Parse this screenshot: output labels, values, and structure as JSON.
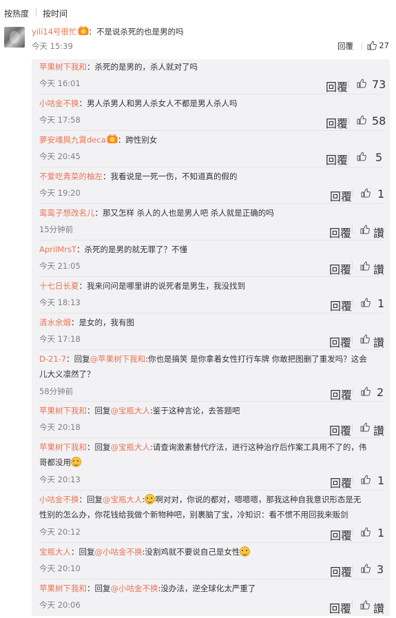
{
  "tabs": {
    "hot": "按热度",
    "time": "按时间"
  },
  "main_comment": {
    "nick": "yili14号很忙",
    "text": "：不是说杀死的也是男的吗",
    "time": "今天 15:39",
    "reply_label": "回覆",
    "likes": "27"
  },
  "replies": [
    {
      "nick": "苹果树下我和",
      "text": "：杀死的是男的，杀人就对了吗",
      "time": "今天 16:01",
      "reply_label": "回覆",
      "likes": "73"
    },
    {
      "nick": "小咕金不换",
      "text": "：男人杀男人和男人杀女人不都是男人杀人吗",
      "time": "今天 17:58",
      "reply_label": "回覆",
      "likes": "58"
    },
    {
      "nick": "夢安魂與九霄deca",
      "text": "：跨性别女",
      "time": "今天 20:45",
      "reply_label": "回覆",
      "likes": "5"
    },
    {
      "nick": "不爱吃青菜的柚左",
      "text": "：我看说是一死一伤，不知道真的假的",
      "time": "今天 19:20",
      "reply_label": "回覆",
      "likes": "1"
    },
    {
      "nick": "鸾鸾子想改名儿",
      "text": "：那又怎样 杀人的人也是男人吧 杀人就是正确的吗",
      "time": "15分钟前",
      "reply_label": "回覆",
      "likes": "讚"
    },
    {
      "nick": "AprilMrsT",
      "text": "：杀死的是男的就无罪了？不懂",
      "time": "今天 21:05",
      "reply_label": "回覆",
      "likes": "讚"
    },
    {
      "nick": "十七日长夏",
      "text": "：我来问问是哪里讲的说死者是男生，我没找到",
      "time": "今天 18:13",
      "reply_label": "回覆",
      "likes": "1"
    },
    {
      "nick": "清水余烟",
      "text": "：是女的，我有图",
      "time": "今天 17:18",
      "reply_label": "回覆",
      "likes": "讚"
    },
    {
      "nick": "D-21-7",
      "pre": "：回复",
      "at": "@苹果树下我和",
      "text": ":你也是搞笑 是你拿着女性打行车牌 你敢把图删了重发吗？这会",
      "text2": "儿大义凛然了？",
      "time": "58分钟前",
      "reply_label": "回覆",
      "likes": "2"
    },
    {
      "nick": "苹果树下我和",
      "pre": "：回复",
      "at": "@宝瓶大人",
      "text": ":鉴于这种言论，去答题吧",
      "time": "今天 20:18",
      "reply_label": "回覆",
      "likes": "讚"
    },
    {
      "nick": "苹果树下我和",
      "pre": "：回复",
      "at": "@宝瓶大人",
      "text": ":请查询激素替代疗法，进行这种治疗后作案工具用不了的，伟",
      "text2": "哥都没用",
      "time": "今天 20:13",
      "reply_label": "回覆",
      "likes": "1"
    },
    {
      "nick": "小咕金不换",
      "pre": "：回复",
      "at": "@宝瓶大人",
      "text": "啊对对，你说的都对，嗯嗯嗯，那我这种自我意识形态是无",
      "text2": "性别的怎么办，你花钱给我做个新物种吧，别裹脑了宝，冷知识：看不惯不用回我来贩剑",
      "time": "今天 20:12",
      "reply_label": "回覆",
      "likes": "1"
    },
    {
      "nick": "宝瓶大人",
      "pre": "：回复",
      "at": "@小咕金不换",
      "text": ":没割鸡就不要说自己是女性",
      "time": "今天 20:10",
      "reply_label": "回覆",
      "likes": "3"
    },
    {
      "nick": "苹果树下我和",
      "pre": "：回复",
      "at": "@小咕金不换",
      "text": ":没办法，逆全球化太严重了",
      "time": "今天 20:06",
      "reply_label": "回覆",
      "likes": "讚"
    }
  ],
  "colors": {
    "nick": "#eb7350",
    "meta": "#808080",
    "reply_bg": "#f2f2f5"
  }
}
